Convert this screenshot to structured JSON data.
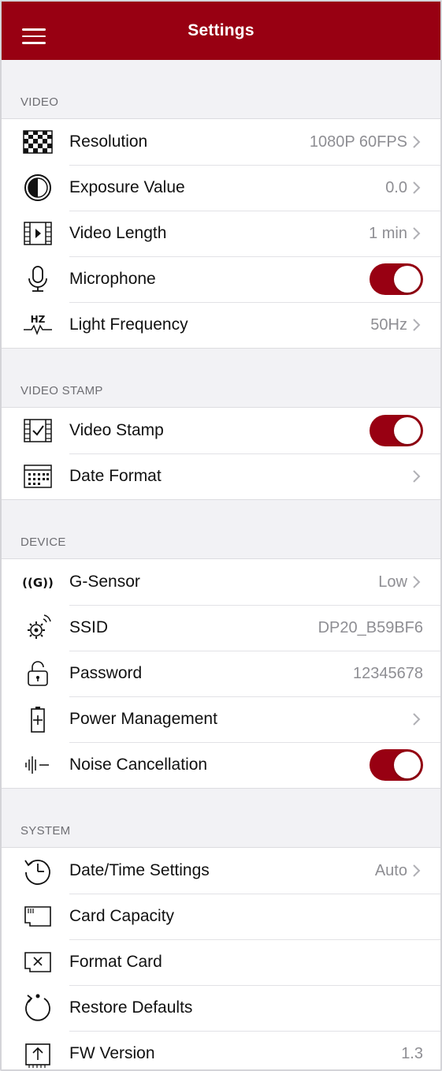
{
  "header": {
    "title": "Settings"
  },
  "sections": {
    "video": {
      "label": "VIDEO",
      "rows": [
        {
          "label": "Resolution",
          "value": "1080P 60FPS"
        },
        {
          "label": "Exposure Value",
          "value": "0.0"
        },
        {
          "label": "Video Length",
          "value": "1 min"
        },
        {
          "label": "Microphone",
          "toggle": true
        },
        {
          "label": "Light Frequency",
          "value": "50Hz"
        }
      ]
    },
    "video_stamp": {
      "label": "VIDEO STAMP",
      "rows": [
        {
          "label": "Video Stamp",
          "toggle": true
        },
        {
          "label": "Date Format"
        }
      ]
    },
    "device": {
      "label": "DEVICE",
      "rows": [
        {
          "label": "G-Sensor",
          "value": "Low"
        },
        {
          "label": "SSID",
          "value": "DP20_B59BF6"
        },
        {
          "label": "Password",
          "value": "12345678"
        },
        {
          "label": "Power Management"
        },
        {
          "label": "Noise Cancellation",
          "toggle": true
        }
      ]
    },
    "system": {
      "label": "SYSTEM",
      "rows": [
        {
          "label": "Date/Time Settings",
          "value": "Auto"
        },
        {
          "label": "Card Capacity"
        },
        {
          "label": "Format Card"
        },
        {
          "label": "Restore Defaults"
        },
        {
          "label": "FW Version",
          "value": "1.3"
        }
      ]
    }
  },
  "icons": {
    "g_sensor_text": "((G))",
    "hz_text": "HZ"
  },
  "colors": {
    "brand": "#980012",
    "secondary_text": "#8e8e93",
    "section_text": "#6e6e73"
  }
}
